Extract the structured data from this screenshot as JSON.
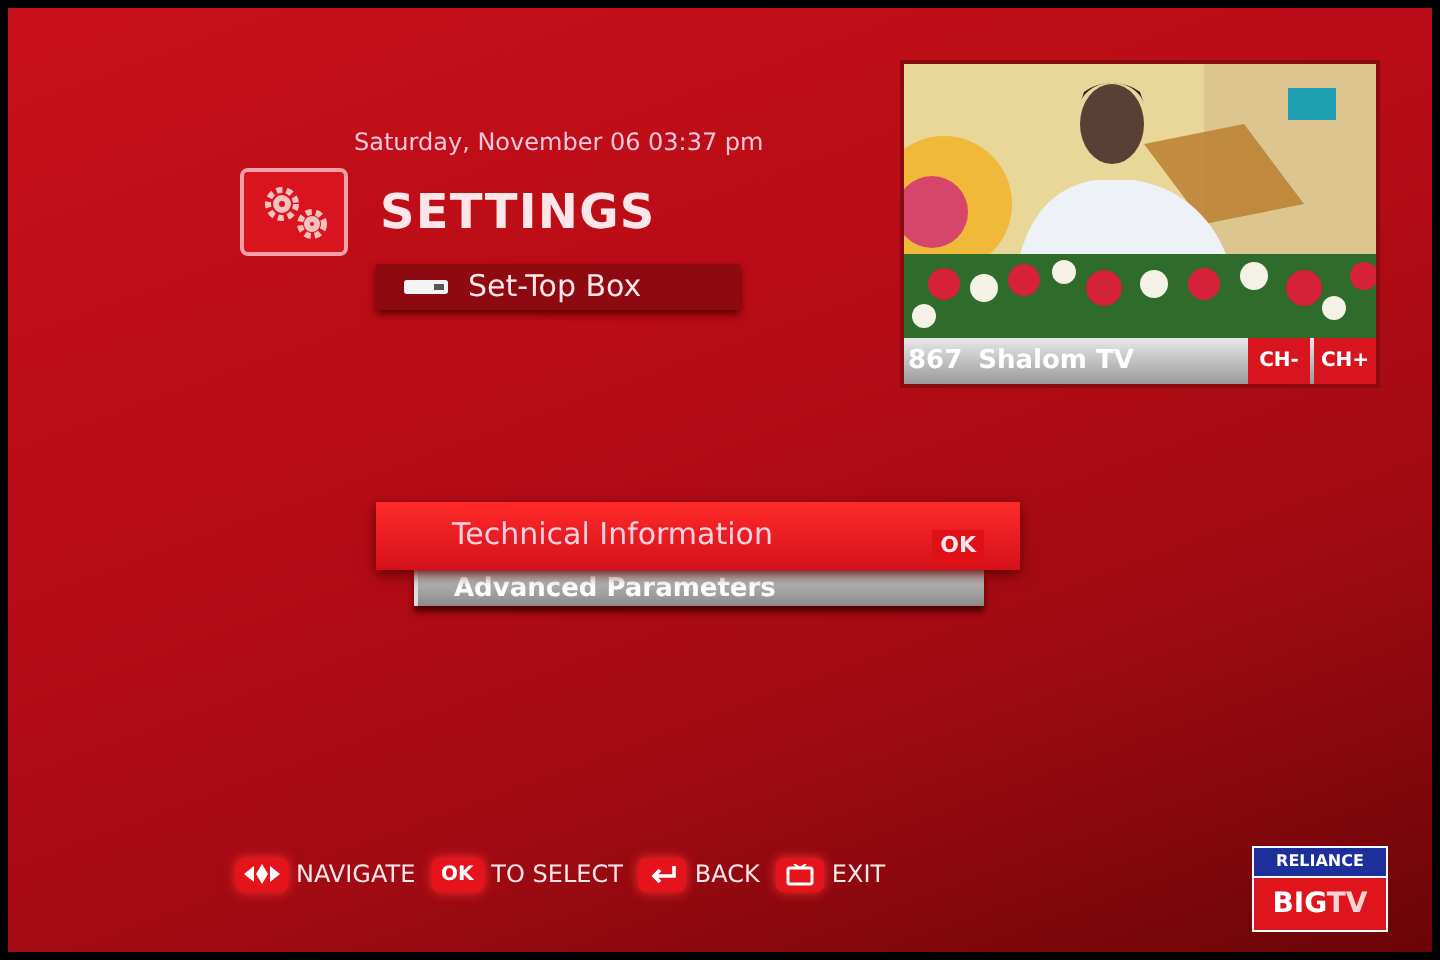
{
  "header": {
    "datetime": "Saturday, November 06  03:37 pm",
    "title": "SETTINGS",
    "subtitle": "Set-Top Box"
  },
  "preview": {
    "channel_number": "867",
    "channel_name": "Shalom TV",
    "buttons": [
      "CH-",
      "CH+"
    ]
  },
  "menu": [
    {
      "label": "Technical Information",
      "selected": true,
      "hint": "OK"
    },
    {
      "label": "Advanced Parameters",
      "selected": false
    }
  ],
  "legend": [
    {
      "kind": "navigate",
      "label": "NAVIGATE"
    },
    {
      "kind": "ok",
      "key": "OK",
      "label": "TO SELECT"
    },
    {
      "kind": "back",
      "label": "BACK"
    },
    {
      "kind": "exit",
      "label": "EXIT"
    }
  ],
  "logo": {
    "top": "RELIANCE",
    "bottom_left": "BIG",
    "bottom_right": "TV"
  }
}
